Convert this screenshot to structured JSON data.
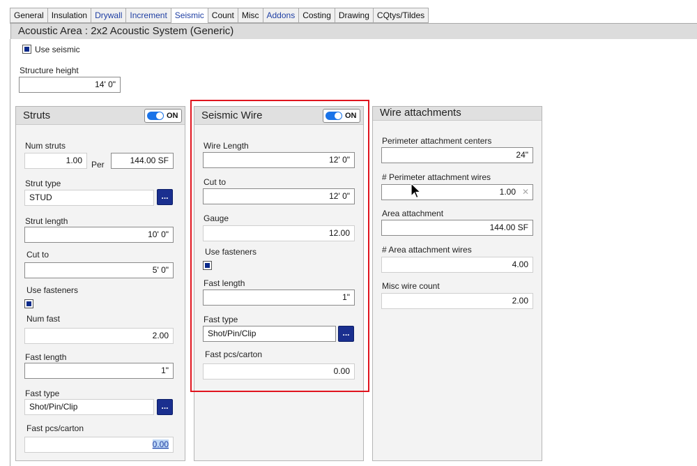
{
  "tabs": [
    {
      "label": "General",
      "link": false
    },
    {
      "label": "Insulation",
      "link": false
    },
    {
      "label": "Drywall",
      "link": true
    },
    {
      "label": "Increment",
      "link": true
    },
    {
      "label": "Seismic",
      "link": false,
      "active": true
    },
    {
      "label": "Count",
      "link": false
    },
    {
      "label": "Misc",
      "link": false
    },
    {
      "label": "Addons",
      "link": true
    },
    {
      "label": "Costing",
      "link": false
    },
    {
      "label": "Drawing",
      "link": false
    },
    {
      "label": "CQtys/Tildes",
      "link": false
    }
  ],
  "title": "Acoustic Area : 2x2 Acoustic System (Generic)",
  "use_seismic": {
    "label": "Use seismic",
    "checked": true
  },
  "structure_height": {
    "label": "Structure height",
    "value": "14' 0\""
  },
  "struts": {
    "title": "Struts",
    "toggle": "ON",
    "num_struts_label": "Num struts",
    "num_struts": "1.00",
    "per_label": "Per",
    "per_value": "144.00 SF",
    "strut_type_label": "Strut type",
    "strut_type": "STUD",
    "strut_length_label": "Strut length",
    "strut_length": "10' 0\"",
    "cut_to_label": "Cut to",
    "cut_to": "5' 0\"",
    "use_fasteners_label": "Use fasteners",
    "use_fasteners": true,
    "num_fast_label": "Num fast",
    "num_fast": "2.00",
    "fast_length_label": "Fast length",
    "fast_length": "1\"",
    "fast_type_label": "Fast type",
    "fast_type": "Shot/Pin/Clip",
    "fast_pcs_label": "Fast pcs/carton",
    "fast_pcs": "0.00",
    "browse": "..."
  },
  "seismic_wire": {
    "title": "Seismic Wire",
    "toggle": "ON",
    "wire_length_label": "Wire Length",
    "wire_length": "12' 0\"",
    "cut_to_label": "Cut to",
    "cut_to": "12' 0\"",
    "gauge_label": "Gauge",
    "gauge": "12.00",
    "use_fasteners_label": "Use fasteners",
    "use_fasteners": true,
    "fast_length_label": "Fast length",
    "fast_length": "1\"",
    "fast_type_label": "Fast type",
    "fast_type": "Shot/Pin/Clip",
    "fast_pcs_label": "Fast pcs/carton",
    "fast_pcs": "0.00",
    "browse": "..."
  },
  "wire_attachments": {
    "title": "Wire attachments",
    "perimeter_centers_label": "Perimeter attachment centers",
    "perimeter_centers": "24\"",
    "perimeter_wires_label": "# Perimeter attachment wires",
    "perimeter_wires": "1.00",
    "area_attachment_label": "Area attachment",
    "area_attachment": "144.00 SF",
    "area_wires_label": "# Area attachment wires",
    "area_wires": "4.00",
    "misc_wire_label": "Misc wire count",
    "misc_wire": "2.00",
    "clear": "✕"
  },
  "colors": {
    "accent": "#1a73e8",
    "highlight_box": "#e0141e",
    "browse_button": "#1a2f8f"
  }
}
